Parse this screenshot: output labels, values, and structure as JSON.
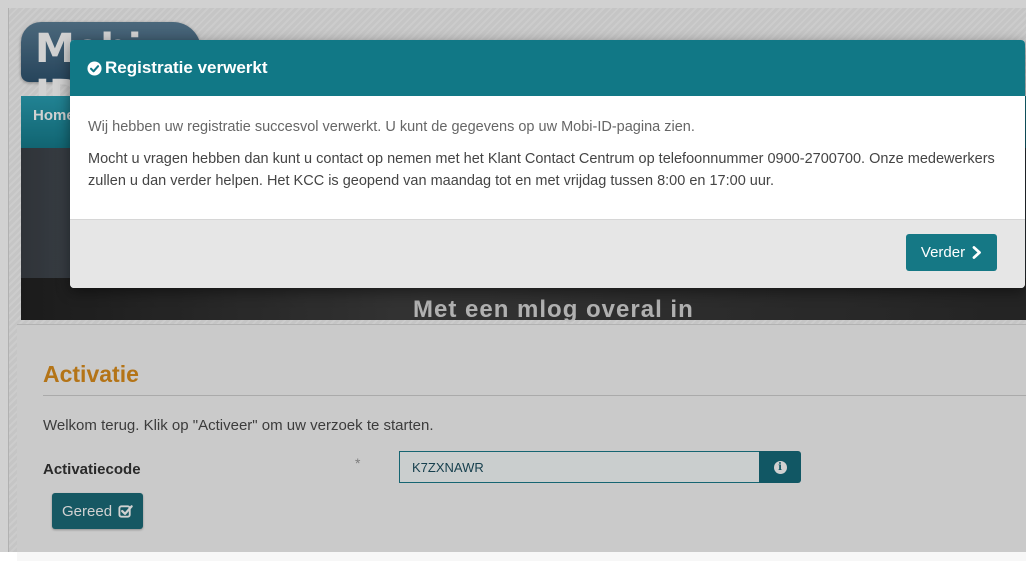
{
  "header": {
    "logo_text": "Mobi-ID"
  },
  "nav": {
    "home_label": "Home"
  },
  "banner": {
    "caption": "Met een mlog overal in"
  },
  "activation": {
    "title": "Activatie",
    "intro": "Welkom terug. Klik op \"Activeer\" om uw verzoek te starten.",
    "field_label": "Activatiecode",
    "required_marker": "*",
    "code_value": "K7ZXNAWR",
    "done_button": "Gereed"
  },
  "modal": {
    "title": "Registratie verwerkt",
    "paragraph_1": "Wij hebben uw registratie succesvol verwerkt. U kunt de gegevens op uw Mobi-ID-pagina zien.",
    "paragraph_2": "Mocht u vragen hebben dan kunt u contact op nemen met het Klant Contact Centrum op telefoonnummer 0900-2700700. Onze medewerkers zullen u dan verder helpen. Het KCC is geopend van maandag tot en met vrijdag tussen 8:00 en 17:00 uur.",
    "continue_button": "Verder"
  },
  "icons": {
    "modal_title_icon": "check-circle-icon",
    "info_icon": "info-icon",
    "done_icon": "check-square-icon",
    "continue_icon": "chevron-right-icon"
  },
  "colors": {
    "accent": "#117886",
    "title_orange": "#dc8e1d",
    "footer_gray": "#e6e6e6"
  }
}
